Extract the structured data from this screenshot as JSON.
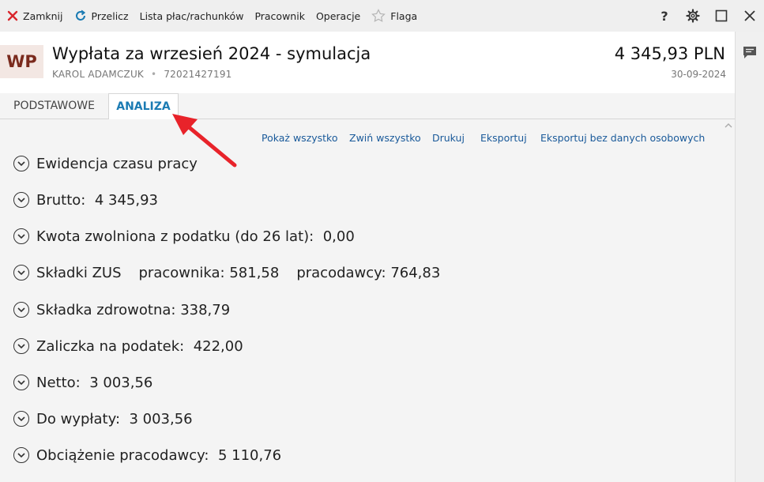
{
  "toolbar": {
    "items": [
      {
        "label": "Zamknij",
        "icon": "close-icon"
      },
      {
        "label": "Przelicz",
        "icon": "refresh-icon"
      },
      {
        "label": "Lista płac/rachunków"
      },
      {
        "label": "Pracownik"
      },
      {
        "label": "Operacje"
      },
      {
        "label": "Flaga",
        "icon": "star-icon"
      }
    ],
    "right_icons": [
      "help-icon",
      "gear-icon",
      "maximize-icon",
      "close-window-icon"
    ],
    "help_glyph": "?"
  },
  "header": {
    "badge": "WP",
    "title": "Wypłata za wrzesień 2024 - symulacja",
    "employee_name": "KAROL ADAMCZUK",
    "separator": "•",
    "employee_id": "72021427191",
    "amount": "4 345,93 PLN",
    "date": "30-09-2024"
  },
  "tabs": [
    {
      "label": "PODSTAWOWE",
      "active": false
    },
    {
      "label": "ANALIZA",
      "active": true
    }
  ],
  "actions": [
    "Pokaż wszystko",
    "Zwiń wszystko",
    "Drukuj",
    "Eksportuj",
    "Eksportuj bez danych osobowych"
  ],
  "sections": {
    "ewidencja": {
      "label": "Ewidencja czasu pracy"
    },
    "brutto": {
      "label": "Brutto:",
      "value": "4 345,93"
    },
    "kwota": {
      "label": "Kwota zwolniona z podatku (do 26 lat):",
      "value": "0,00"
    },
    "zus": {
      "label": "Składki ZUS",
      "employee_label": "pracownika:",
      "employee_value": "581,58",
      "employer_label": "pracodawcy:",
      "employer_value": "764,83"
    },
    "zdrowotna": {
      "label": "Składka zdrowotna:",
      "value": "338,79"
    },
    "zaliczka": {
      "label": "Zaliczka na podatek:",
      "value": "422,00"
    },
    "netto": {
      "label": "Netto:",
      "value": "3 003,56"
    },
    "do_wyplaty": {
      "label": "Do wypłaty:",
      "value": "3 003,56"
    },
    "obciazenie": {
      "label": "Obciążenie pracodawcy:",
      "value": "5 110,76"
    }
  },
  "colors": {
    "accent": "#1b7bb3",
    "close_red": "#d9262c",
    "annotation_arrow": "#e8232a"
  }
}
